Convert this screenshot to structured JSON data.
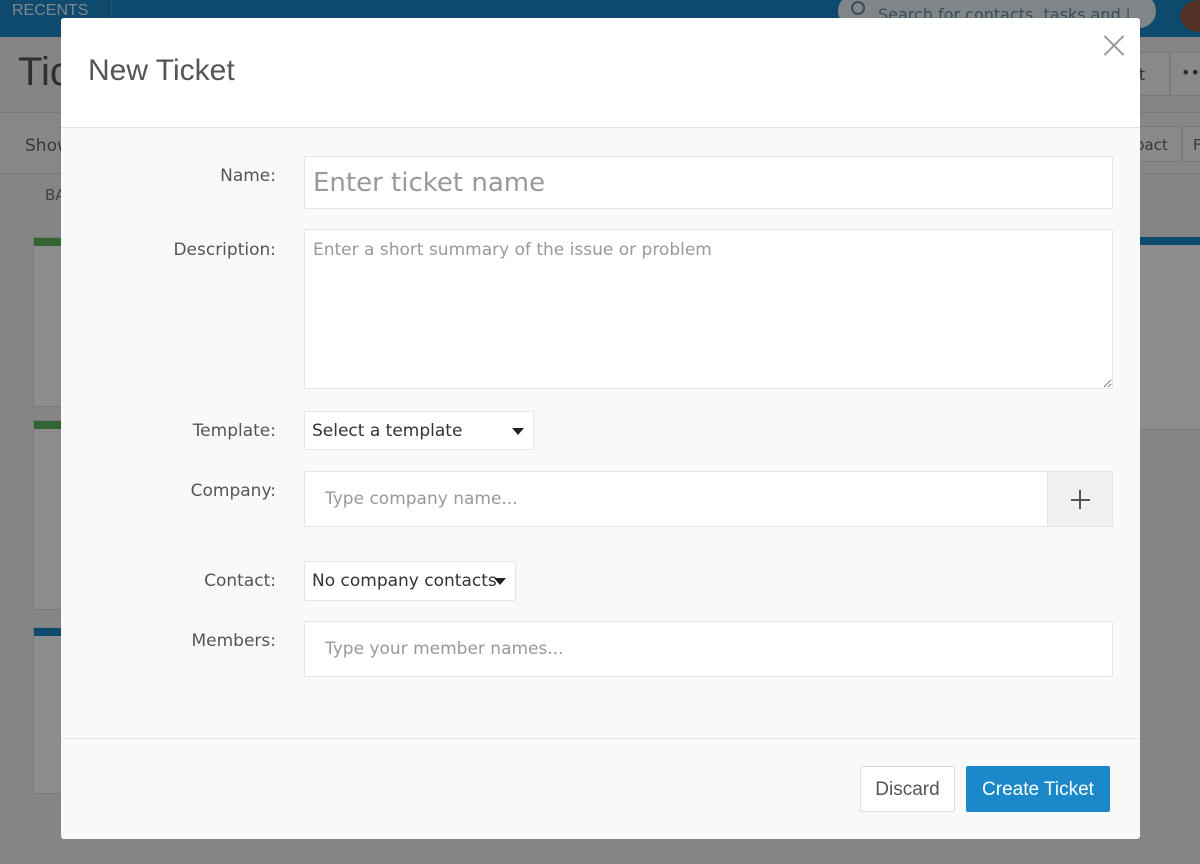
{
  "background": {
    "recents_label": "RECENTS",
    "search_placeholder": "Search for contacts, tasks and i",
    "page_title": "Tic",
    "show_label": "Show",
    "tab_label": "BA",
    "right_button_label": "et",
    "more_label": "•••",
    "right_tab_label": "pact",
    "right_tab2_label": "F",
    "accent_color": "#1a88c9"
  },
  "modal": {
    "title": "New Ticket",
    "fields": {
      "name": {
        "label": "Name:",
        "placeholder": "Enter ticket name"
      },
      "description": {
        "label": "Description:",
        "placeholder": "Enter a short summary of the issue or problem"
      },
      "template": {
        "label": "Template:",
        "selected": "Select a template"
      },
      "company": {
        "label": "Company:",
        "placeholder": "Type company name..."
      },
      "contact": {
        "label": "Contact:",
        "selected": "No company contacts"
      },
      "members": {
        "label": "Members:",
        "placeholder": "Type your member names..."
      }
    },
    "buttons": {
      "discard": "Discard",
      "create": "Create Ticket"
    }
  }
}
